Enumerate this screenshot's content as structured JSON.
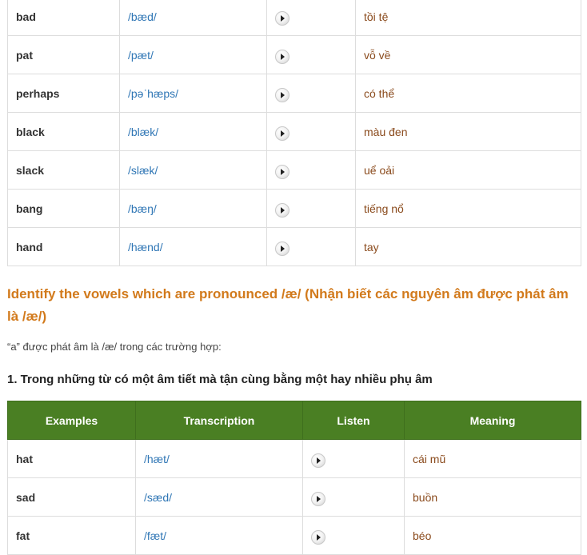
{
  "table1": {
    "rows": [
      {
        "word": "bad",
        "ipa": "/bæd/",
        "meaning": "tồi tệ"
      },
      {
        "word": "pat",
        "ipa": "/pæt/",
        "meaning": "vỗ về"
      },
      {
        "word": "perhaps",
        "ipa": "/pəˈhæps/",
        "meaning": "có thể"
      },
      {
        "word": "black",
        "ipa": "/blæk/",
        "meaning": "màu đen"
      },
      {
        "word": "slack",
        "ipa": "/slæk/",
        "meaning": "uể oải"
      },
      {
        "word": "bang",
        "ipa": "/bæŋ/",
        "meaning": "tiếng nổ"
      },
      {
        "word": "hand",
        "ipa": "/hænd/",
        "meaning": "tay"
      }
    ]
  },
  "section": {
    "heading": "Identify the vowels which are pronounced /æ/ (Nhận biết các nguyên âm được phát âm là /æ/)",
    "intro": "“a” được phát âm là /æ/ trong các trường hợp:",
    "rule1": "1. Trong những từ có một âm tiết mà tận cùng bằng một hay nhiều phụ âm"
  },
  "table2": {
    "headers": [
      "Examples",
      "Transcription",
      "Listen",
      "Meaning"
    ],
    "rows": [
      {
        "word": "hat",
        "ipa": "/hæt/",
        "meaning": "cái mũ"
      },
      {
        "word": "sad",
        "ipa": "/sæd/",
        "meaning": "buồn"
      },
      {
        "word": "fat",
        "ipa": "/fæt/",
        "meaning": "béo"
      }
    ]
  },
  "colors": {
    "heading": "#d27a1c",
    "header_bg": "#4a7f23",
    "ipa": "#2f76b5",
    "meaning": "#8a4a1c"
  },
  "icons": {
    "listen": "play-icon"
  }
}
